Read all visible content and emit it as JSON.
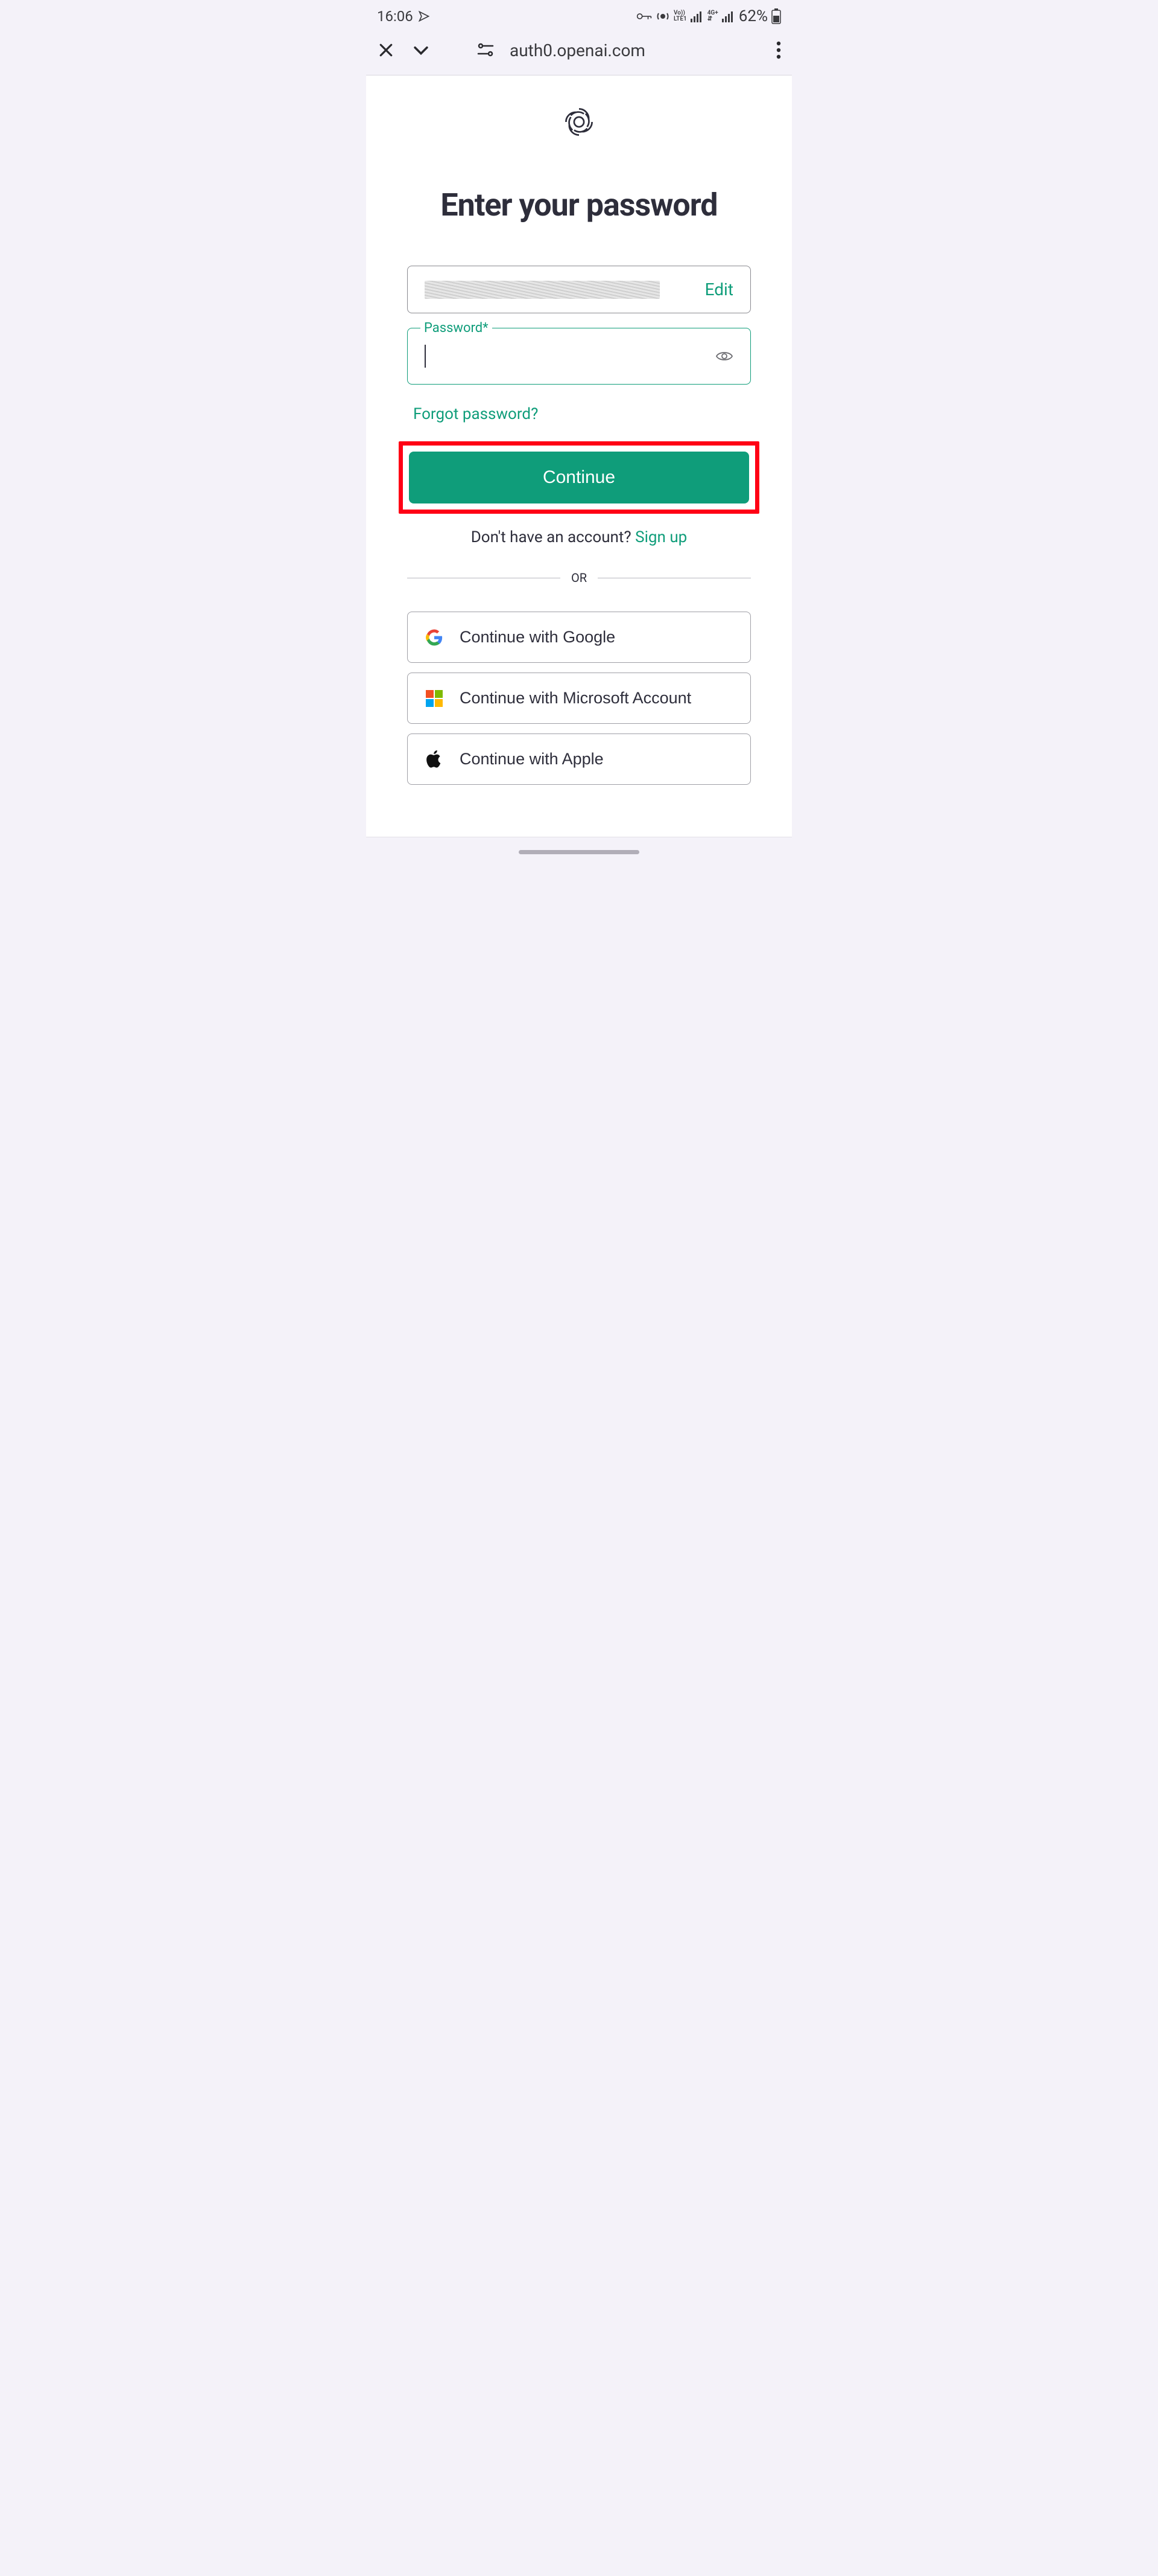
{
  "status": {
    "time": "16:06",
    "lte_label_top": "Vo))",
    "lte_label_bot": "LTE1",
    "net_label": "4G+",
    "battery_pct": "62%"
  },
  "browser": {
    "url": "auth0.openai.com"
  },
  "page": {
    "title": "Enter your password",
    "edit": "Edit",
    "password_label": "Password*",
    "password_value": "",
    "forgot": "Forgot password?",
    "continue": "Continue",
    "no_account": "Don't have an account? ",
    "signup": "Sign up",
    "or": "OR",
    "google": "Continue with Google",
    "microsoft": "Continue with Microsoft Account",
    "apple": "Continue with Apple"
  },
  "colors": {
    "accent": "#0f9d7a",
    "highlight": "#ff0015"
  }
}
